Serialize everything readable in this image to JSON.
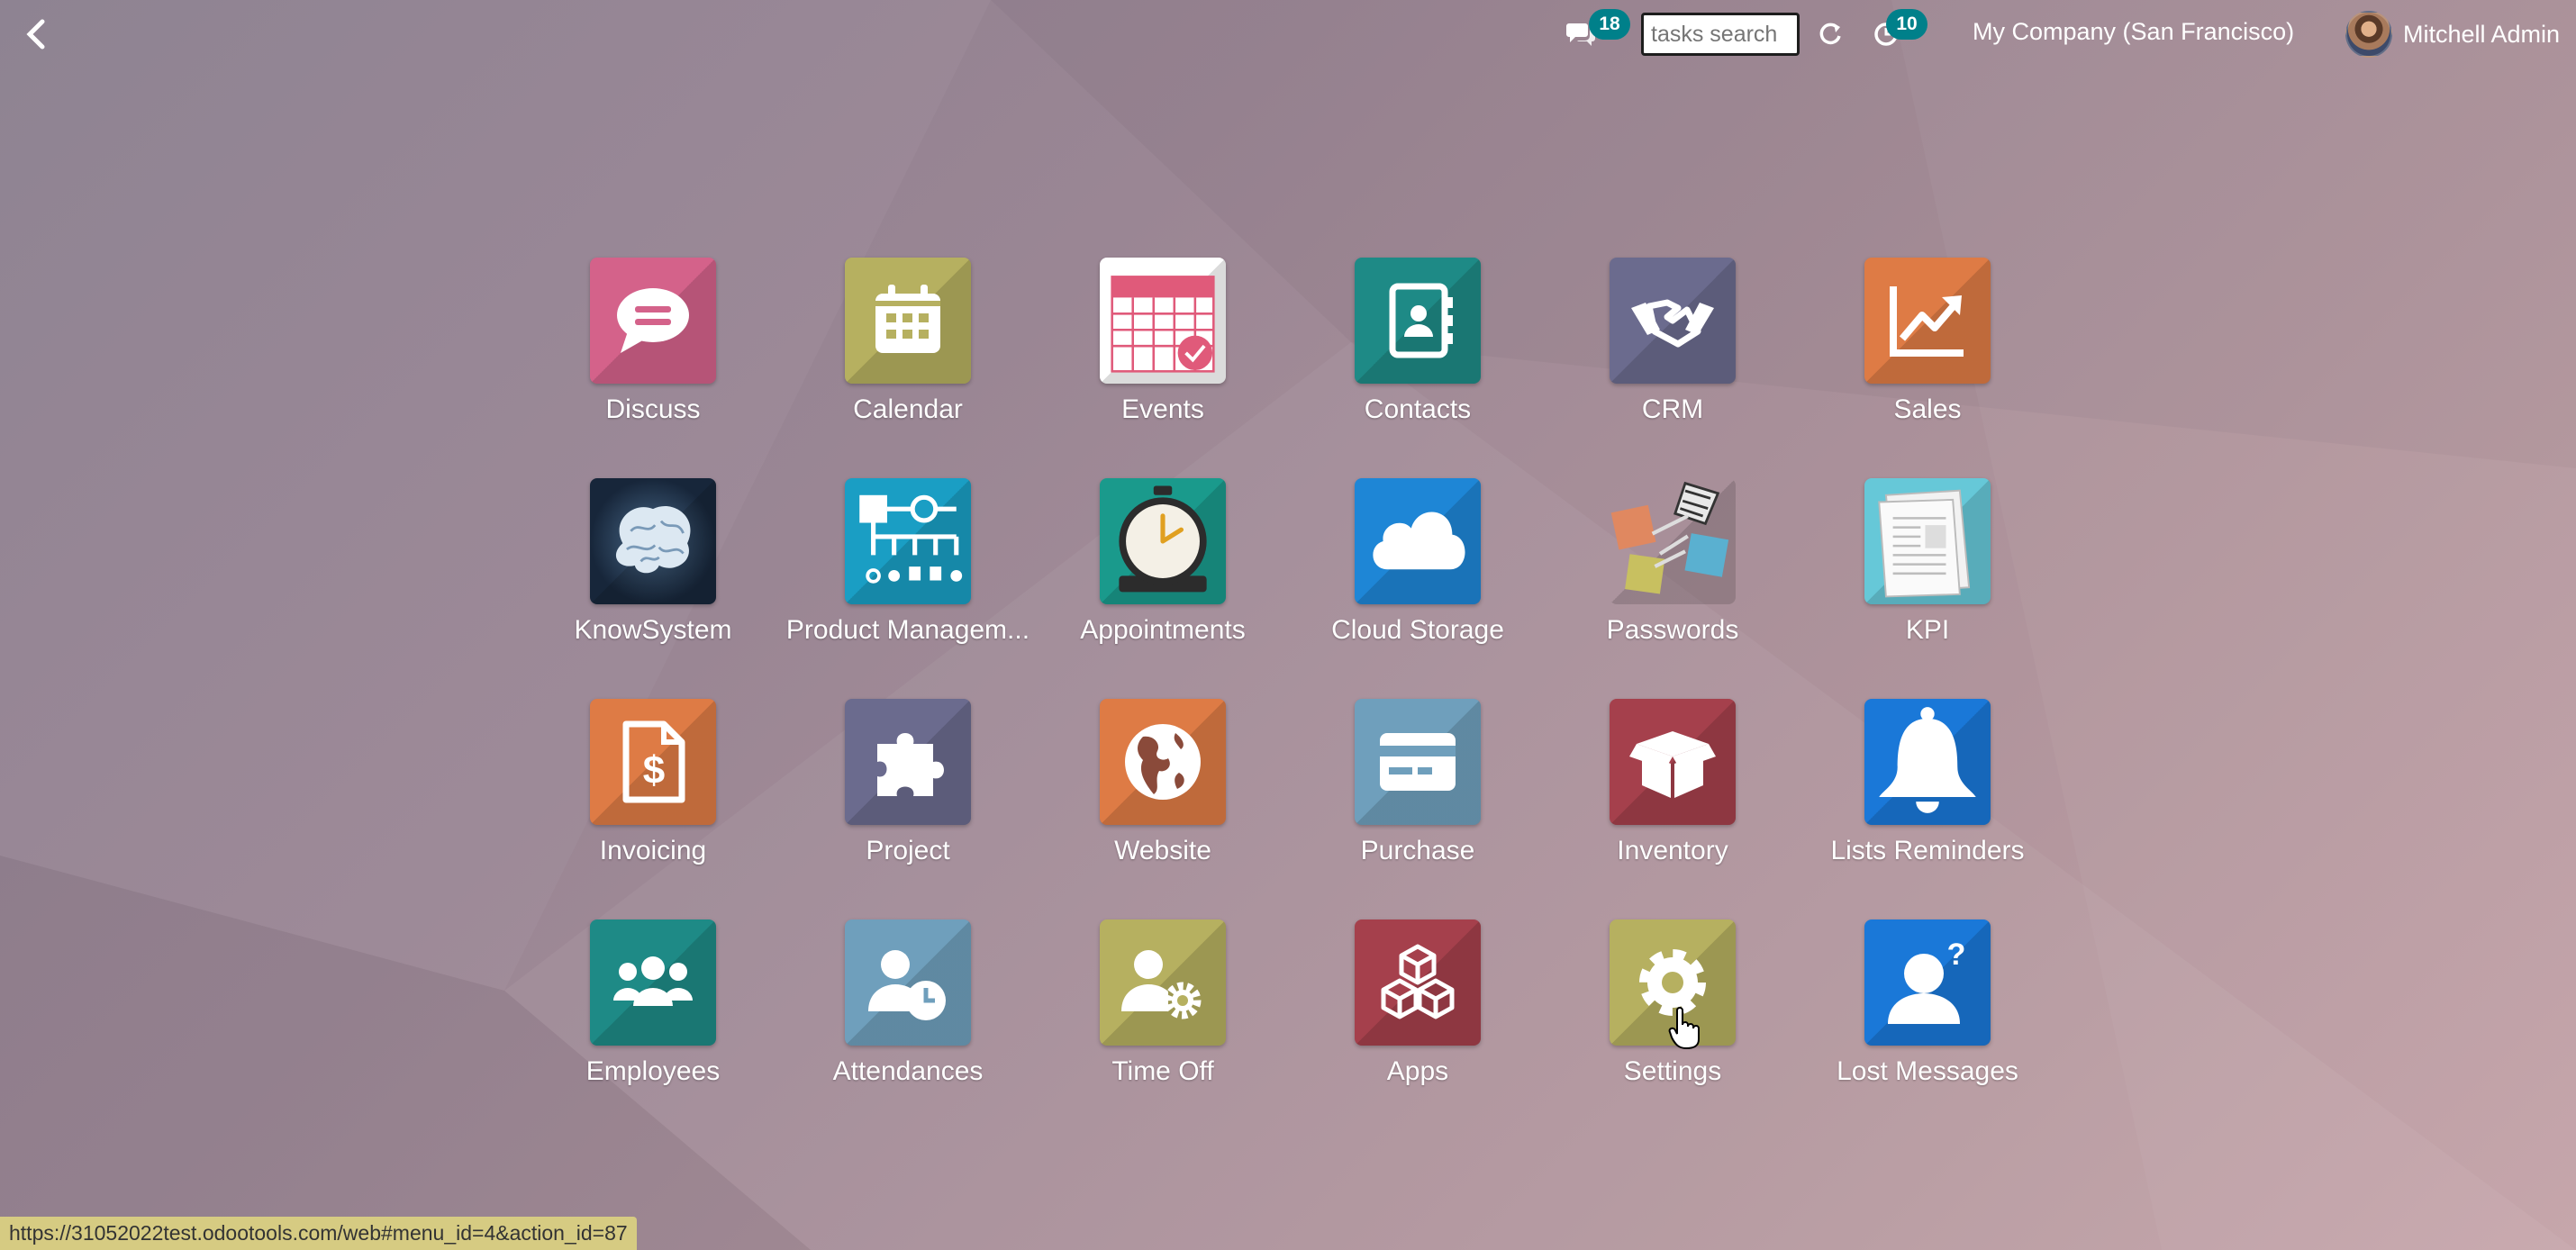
{
  "topbar": {
    "chat_badge": "18",
    "activity_badge": "10",
    "search_placeholder": "tasks search",
    "company": "My Company (San Francisco)",
    "user_name": "Mitchell Admin"
  },
  "apps": [
    {
      "label": "Discuss",
      "color": "#d4628a",
      "icon": "chat-bubble-icon"
    },
    {
      "label": "Calendar",
      "color": "#b6b060",
      "icon": "calendar-icon"
    },
    {
      "label": "Events",
      "color": "#ffffff",
      "icon": "event-calendar-icon"
    },
    {
      "label": "Contacts",
      "color": "#1e8a86",
      "icon": "contact-book-icon"
    },
    {
      "label": "CRM",
      "color": "#6b6b8e",
      "icon": "handshake-icon"
    },
    {
      "label": "Sales",
      "color": "#de7b45",
      "icon": "trend-chart-icon"
    },
    {
      "label": "KnowSystem",
      "color": "#1b2a3a",
      "icon": "brain-icon"
    },
    {
      "label": "Product Managem...",
      "color": "#1a9ec4",
      "icon": "product-tree-icon"
    },
    {
      "label": "Appointments",
      "color": "#1a9a8c",
      "icon": "stopwatch-icon"
    },
    {
      "label": "Cloud Storage",
      "color": "#1e86d6",
      "icon": "cloud-icon"
    },
    {
      "label": "Passwords",
      "color": "#a08c98",
      "icon": "padlocks-icon"
    },
    {
      "label": "KPI",
      "color": "#66c8d8",
      "icon": "newspaper-icon"
    },
    {
      "label": "Invoicing",
      "color": "#de7b45",
      "icon": "invoice-icon"
    },
    {
      "label": "Project",
      "color": "#6b6b8e",
      "icon": "puzzle-icon"
    },
    {
      "label": "Website",
      "color": "#de7b45",
      "icon": "globe-icon"
    },
    {
      "label": "Purchase",
      "color": "#6f9fbc",
      "icon": "credit-card-icon"
    },
    {
      "label": "Inventory",
      "color": "#a5404c",
      "icon": "box-icon"
    },
    {
      "label": "Lists Reminders",
      "color": "#1a78d8",
      "icon": "bell-icon"
    },
    {
      "label": "Employees",
      "color": "#1e8a86",
      "icon": "people-icon"
    },
    {
      "label": "Attendances",
      "color": "#6f9fbc",
      "icon": "user-clock-icon"
    },
    {
      "label": "Time Off",
      "color": "#b6b060",
      "icon": "user-gear-icon"
    },
    {
      "label": "Apps",
      "color": "#a5404c",
      "icon": "cubes-icon"
    },
    {
      "label": "Settings",
      "color": "#b6b060",
      "icon": "gear-icon"
    },
    {
      "label": "Lost Messages",
      "color": "#1a78d8",
      "icon": "user-question-icon"
    }
  ],
  "status_url": "https://31052022test.odootools.com/web#menu_id=4&action_id=87"
}
